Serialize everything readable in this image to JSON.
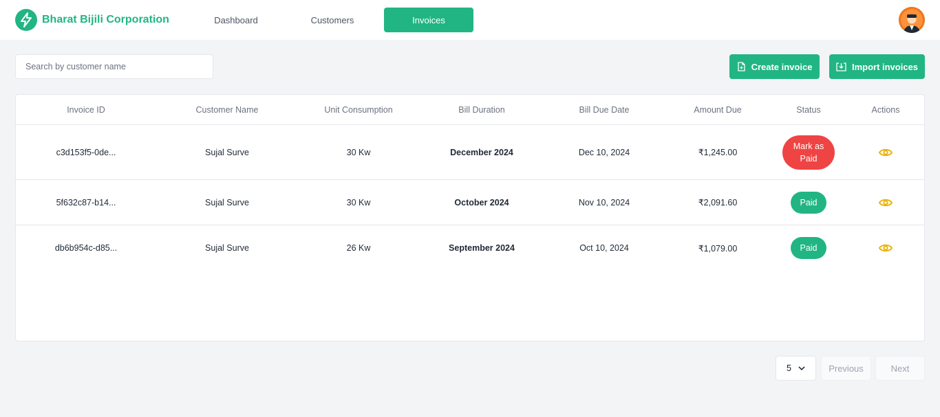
{
  "brand": {
    "name": "Bharat Bijili Corporation",
    "icon": "lightning-bolt-icon",
    "color": "#21b584"
  },
  "nav": {
    "tabs": [
      {
        "label": "Dashboard",
        "active": false
      },
      {
        "label": "Customers",
        "active": false
      },
      {
        "label": "Invoices",
        "active": true
      }
    ],
    "avatar": "user-avatar-icon"
  },
  "toolbar": {
    "search_placeholder": "Search by customer name",
    "search_value": "",
    "create_label": "Create invoice",
    "import_label": "Import invoices"
  },
  "table": {
    "columns": [
      "Invoice ID",
      "Customer Name",
      "Unit Consumption",
      "Bill Duration",
      "Bill Due Date",
      "Amount Due",
      "Status",
      "Actions"
    ],
    "rows": [
      {
        "invoice_id": "c3d153f5-0de...",
        "customer": "Sujal Surve",
        "units": "30 Kw",
        "duration": "December 2024",
        "due_date": "Dec 10, 2024",
        "amount": "₹1,245.00",
        "status": "Mark as Paid",
        "status_color": "#ef4444"
      },
      {
        "invoice_id": "5f632c87-b14...",
        "customer": "Sujal Surve",
        "units": "30 Kw",
        "duration": "October 2024",
        "due_date": "Nov 10, 2024",
        "amount": "₹2,091.60",
        "status": "Paid",
        "status_color": "#21b584"
      },
      {
        "invoice_id": "db6b954c-d85...",
        "customer": "Sujal Surve",
        "units": "26 Kw",
        "duration": "September 2024",
        "due_date": "Oct 10, 2024",
        "amount": "₹1,079.00",
        "status": "Paid",
        "status_color": "#21b584"
      }
    ],
    "action_icon": "eye-icon",
    "action_color": "#eab308"
  },
  "pagination": {
    "page_size": "5",
    "previous_label": "Previous",
    "next_label": "Next"
  }
}
